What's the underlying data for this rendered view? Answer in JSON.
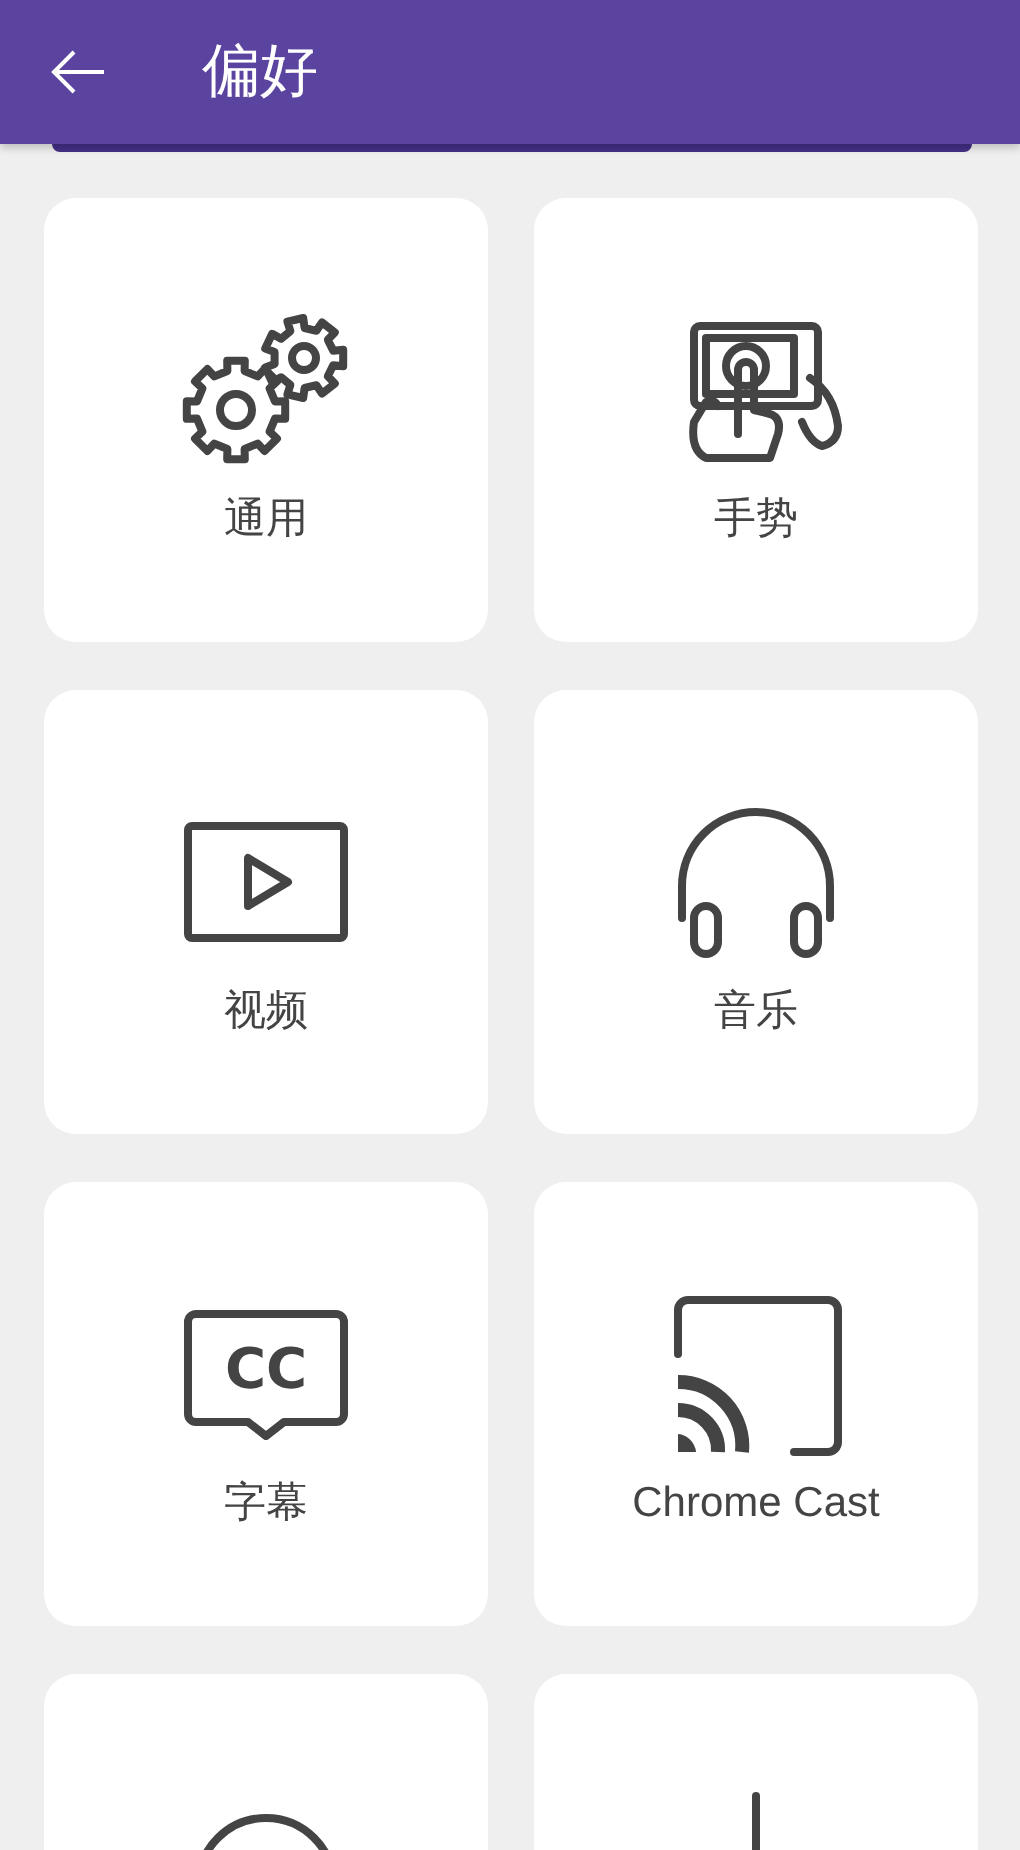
{
  "app_bar": {
    "title": "偏好"
  },
  "items": [
    {
      "kind": "gears",
      "label": "通用"
    },
    {
      "kind": "gesture",
      "label": "手势"
    },
    {
      "kind": "video",
      "label": "视频"
    },
    {
      "kind": "headphones",
      "label": "音乐"
    },
    {
      "kind": "cc",
      "icon_text": "CC",
      "label": "字幕"
    },
    {
      "kind": "cast",
      "label": "Chrome Cast"
    },
    {
      "kind": "circle"
    },
    {
      "kind": "stem"
    }
  ]
}
